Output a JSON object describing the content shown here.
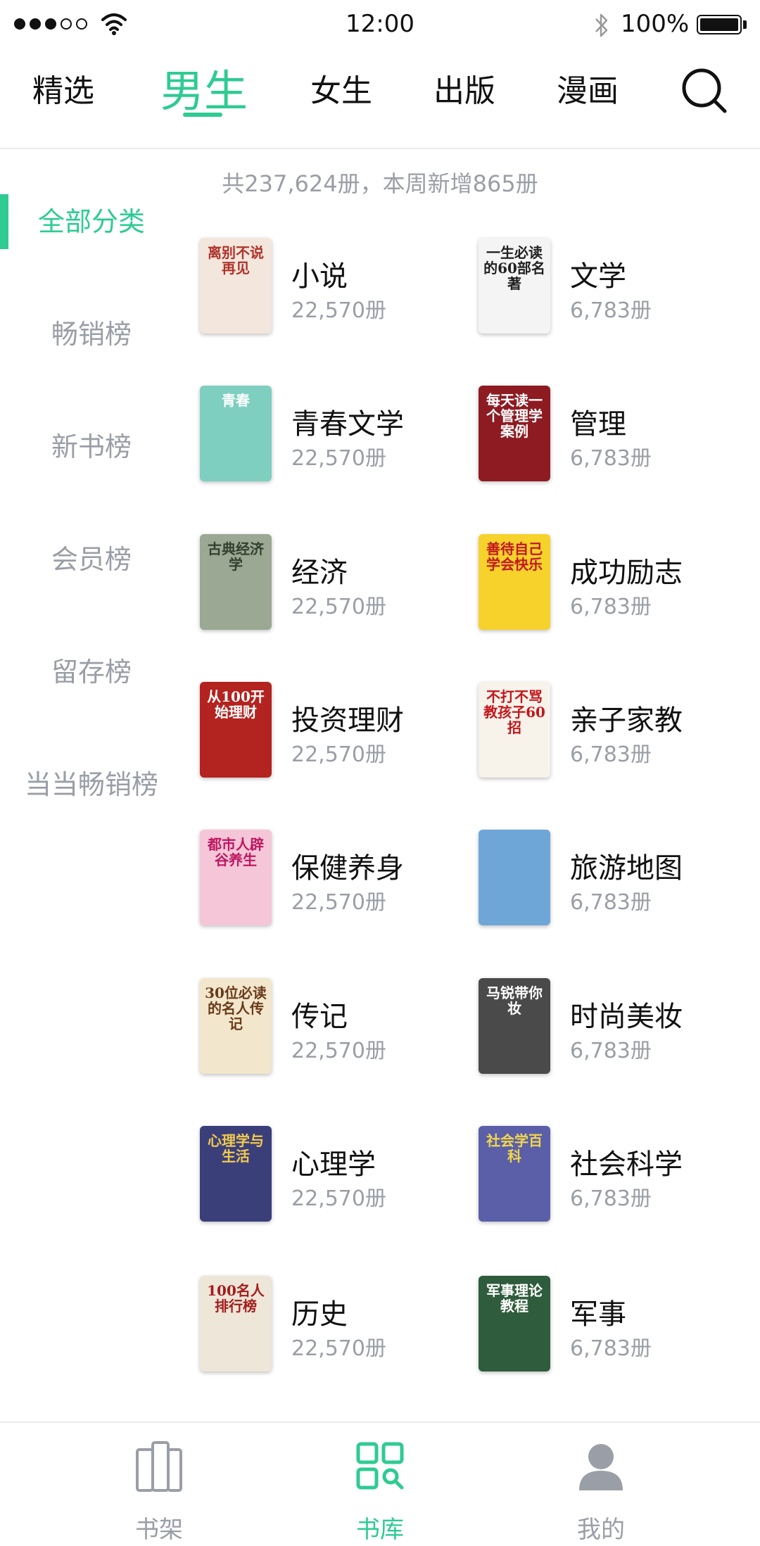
{
  "status": {
    "time": "12:00",
    "battery": "100%"
  },
  "nav": {
    "tabs": [
      {
        "label": "精选",
        "active": false
      },
      {
        "label": "男生",
        "active": true
      },
      {
        "label": "女生",
        "active": false
      },
      {
        "label": "出版",
        "active": false
      },
      {
        "label": "漫画",
        "active": false
      }
    ]
  },
  "summary": "共237,624册，本周新增865册",
  "sidebar": {
    "items": [
      {
        "label": "全部分类",
        "active": true
      },
      {
        "label": "畅销榜",
        "active": false
      },
      {
        "label": "新书榜",
        "active": false
      },
      {
        "label": "会员榜",
        "active": false
      },
      {
        "label": "留存榜",
        "active": false
      },
      {
        "label": "当当畅销榜",
        "active": false
      }
    ]
  },
  "categories": [
    {
      "name": "小说",
      "count": "22,570册",
      "cover_text": "离别不说再见",
      "cover_bg": "#f3e6dc",
      "cover_fg": "#b0332b"
    },
    {
      "name": "文学",
      "count": "6,783册",
      "cover_text": "一生必读的60部名著",
      "cover_bg": "#f4f4f4",
      "cover_fg": "#222222"
    },
    {
      "name": "青春文学",
      "count": "22,570册",
      "cover_text": "青春",
      "cover_bg": "#7fcfc0",
      "cover_fg": "#ffffff"
    },
    {
      "name": "管理",
      "count": "6,783册",
      "cover_text": "每天读一个管理学案例",
      "cover_bg": "#8e1b22",
      "cover_fg": "#ffffff"
    },
    {
      "name": "经济",
      "count": "22,570册",
      "cover_text": "古典经济学",
      "cover_bg": "#9aa894",
      "cover_fg": "#33402f"
    },
    {
      "name": "成功励志",
      "count": "6,783册",
      "cover_text": "善待自己 学会快乐",
      "cover_bg": "#f6d22b",
      "cover_fg": "#c4161c"
    },
    {
      "name": "投资理财",
      "count": "22,570册",
      "cover_text": "从100开始理财",
      "cover_bg": "#b3231f",
      "cover_fg": "#ffffff"
    },
    {
      "name": "亲子家教",
      "count": "6,783册",
      "cover_text": "不打不骂教孩子60招",
      "cover_bg": "#f7f2ea",
      "cover_fg": "#c4161c"
    },
    {
      "name": "保健养身",
      "count": "22,570册",
      "cover_text": "都市人辟谷养生",
      "cover_bg": "#f4c6d8",
      "cover_fg": "#c01761"
    },
    {
      "name": "旅游地图",
      "count": "6,783册",
      "cover_text": "",
      "cover_bg": "#6fa6d8",
      "cover_fg": "#ffffff"
    },
    {
      "name": "传记",
      "count": "22,570册",
      "cover_text": "30位必读的名人传记",
      "cover_bg": "#f2e7cc",
      "cover_fg": "#6b3a1a"
    },
    {
      "name": "时尚美妆",
      "count": "6,783册",
      "cover_text": "马锐带你妆",
      "cover_bg": "#4a4a4a",
      "cover_fg": "#ffffff"
    },
    {
      "name": "心理学",
      "count": "22,570册",
      "cover_text": "心理学与生活",
      "cover_bg": "#3a3f7a",
      "cover_fg": "#f2c94c"
    },
    {
      "name": "社会科学",
      "count": "6,783册",
      "cover_text": "社会学百科",
      "cover_bg": "#5a5fa8",
      "cover_fg": "#f2d64b"
    },
    {
      "name": "历史",
      "count": "22,570册",
      "cover_text": "100名人排行榜",
      "cover_bg": "#eee6d8",
      "cover_fg": "#a31d1d"
    },
    {
      "name": "军事",
      "count": "6,783册",
      "cover_text": "军事理论教程",
      "cover_bg": "#2f5c3c",
      "cover_fg": "#ffffff"
    }
  ],
  "bottom_bar": {
    "tabs": [
      {
        "label": "书架",
        "icon": "bookshelf-icon",
        "active": false
      },
      {
        "label": "书库",
        "icon": "library-grid-icon",
        "active": true
      },
      {
        "label": "我的",
        "icon": "user-icon",
        "active": false
      }
    ]
  },
  "colors": {
    "accent": "#2ecb92",
    "muted": "#9a9ea6"
  }
}
